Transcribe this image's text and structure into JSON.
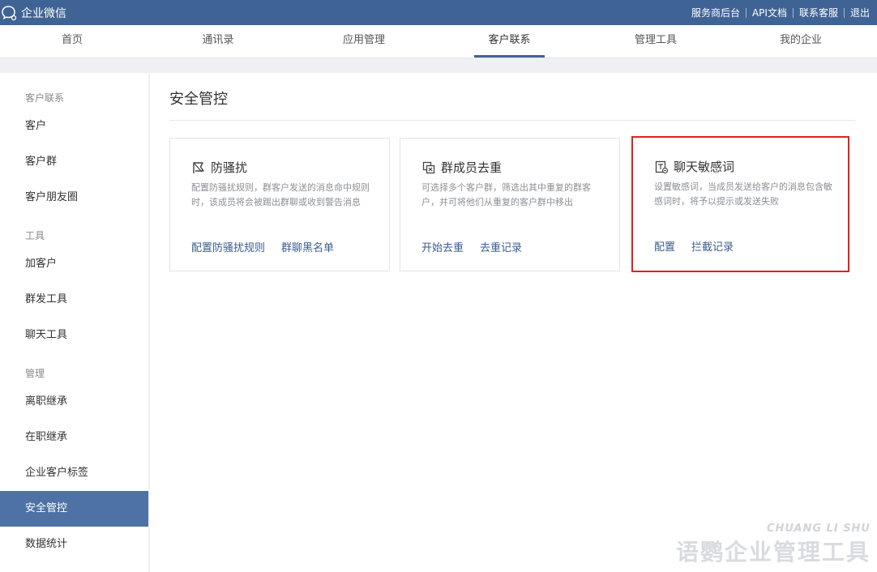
{
  "topbar": {
    "brand": "企业微信",
    "links": [
      "服务商后台",
      "API文档",
      "联系客服",
      "退出"
    ]
  },
  "nav": {
    "tabs": [
      "首页",
      "通讯录",
      "应用管理",
      "客户联系",
      "管理工具",
      "我的企业"
    ],
    "active": "客户联系"
  },
  "sidebar": {
    "section_customer": "客户联系",
    "customer_items": [
      "客户",
      "客户群",
      "客户朋友圈"
    ],
    "section_tools": "工具",
    "tool_items": [
      "加客户",
      "群发工具",
      "聊天工具"
    ],
    "section_manage": "管理",
    "manage_items": [
      "离职继承",
      "在职继承",
      "企业客户标签",
      "安全管控",
      "数据统计"
    ],
    "active": "安全管控"
  },
  "main": {
    "title": "安全管控",
    "cards": [
      {
        "title": "防骚扰",
        "icon": "flag-icon",
        "desc": "配置防骚扰规则，群客户发送的消息命中规则时，该成员将会被踢出群聊或收到警告消息",
        "links": [
          "配置防骚扰规则",
          "群聊黑名单"
        ]
      },
      {
        "title": "群成员去重",
        "icon": "dedupe-icon",
        "desc": "可选择多个客户群，筛选出其中重复的群客户，并可将他们从重复的客户群中移出",
        "links": [
          "开始去重",
          "去重记录"
        ]
      },
      {
        "title": "聊天敏感词",
        "icon": "sensitive-word-icon",
        "desc": "设置敏感词，当成员发送给客户的消息包含敏感词时，将予以提示或发送失败",
        "links": [
          "配置",
          "拦截记录"
        ]
      }
    ]
  },
  "watermark": {
    "en": "CHUANG LI SHU",
    "cn": "语鹦企业管理工具"
  },
  "colors": {
    "topbar": "#3f6394",
    "sidebar_active": "#4e72a5",
    "link": "#3a5d8f",
    "highlight_border": "#e02020"
  }
}
